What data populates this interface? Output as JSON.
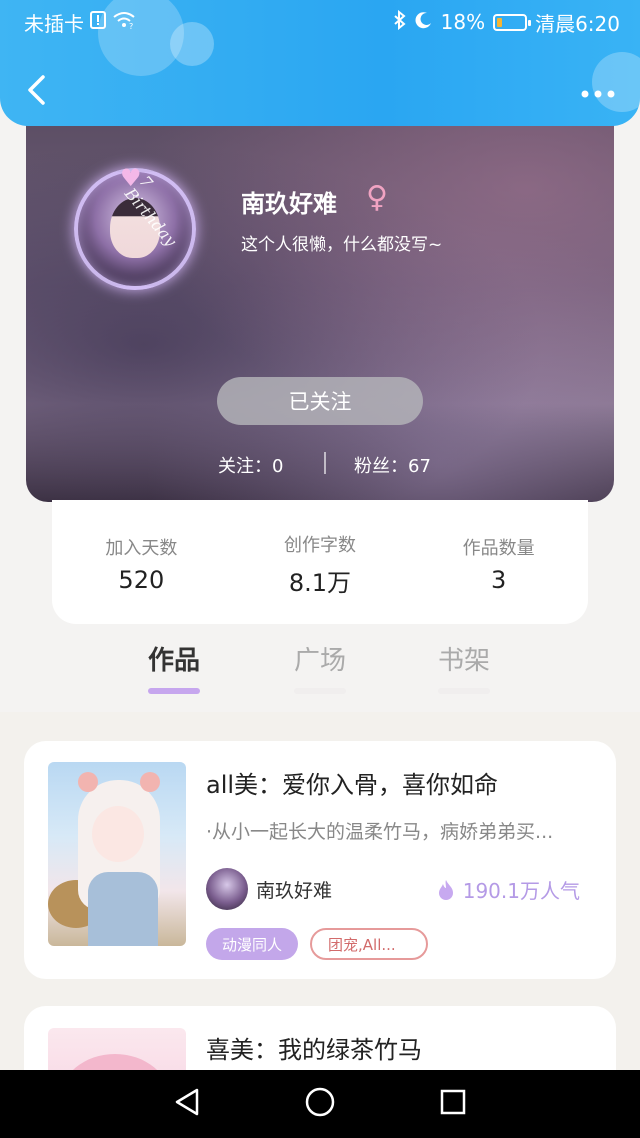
{
  "status_bar": {
    "carrier": "未插卡",
    "battery_percent": "18%",
    "battery_level": 0.18,
    "time": "清晨6:20"
  },
  "profile": {
    "name": "南玖好难",
    "bio": "这个人很懒，什么都没写~",
    "avatar_text": "7 Birthday",
    "follow_button": "已关注",
    "following_label": "关注：",
    "following_value": "0",
    "fans_label": "粉丝：",
    "fans_value": "67"
  },
  "stats": [
    {
      "label": "加入天数",
      "value": "520"
    },
    {
      "label": "创作字数",
      "value": "8.1万"
    },
    {
      "label": "作品数量",
      "value": "3"
    }
  ],
  "tabs": [
    {
      "label": "作品",
      "active": true
    },
    {
      "label": "广场",
      "active": false
    },
    {
      "label": "书架",
      "active": false
    }
  ],
  "works": [
    {
      "title": "all美：爱你入骨，喜你如命",
      "description": "·从小一起长大的温柔竹马，病娇弟弟买...",
      "author": "南玖好难",
      "popularity": "190.1万人气",
      "tags": [
        "动漫同人",
        "团宠,All..."
      ]
    },
    {
      "title": "喜美：我的绿茶竹马"
    }
  ],
  "colors": {
    "header_blue": "#2aa6f2",
    "accent_purple": "#c3a7ea",
    "tag_red": "#e69a9a",
    "gender_pink": "#f0a3c2"
  },
  "icons": {
    "back": "back-arrow-icon",
    "more": "more-dots-icon",
    "gender": "female-icon",
    "fire": "fire-icon",
    "nav": [
      "nav-back-icon",
      "nav-home-icon",
      "nav-recents-icon"
    ]
  }
}
